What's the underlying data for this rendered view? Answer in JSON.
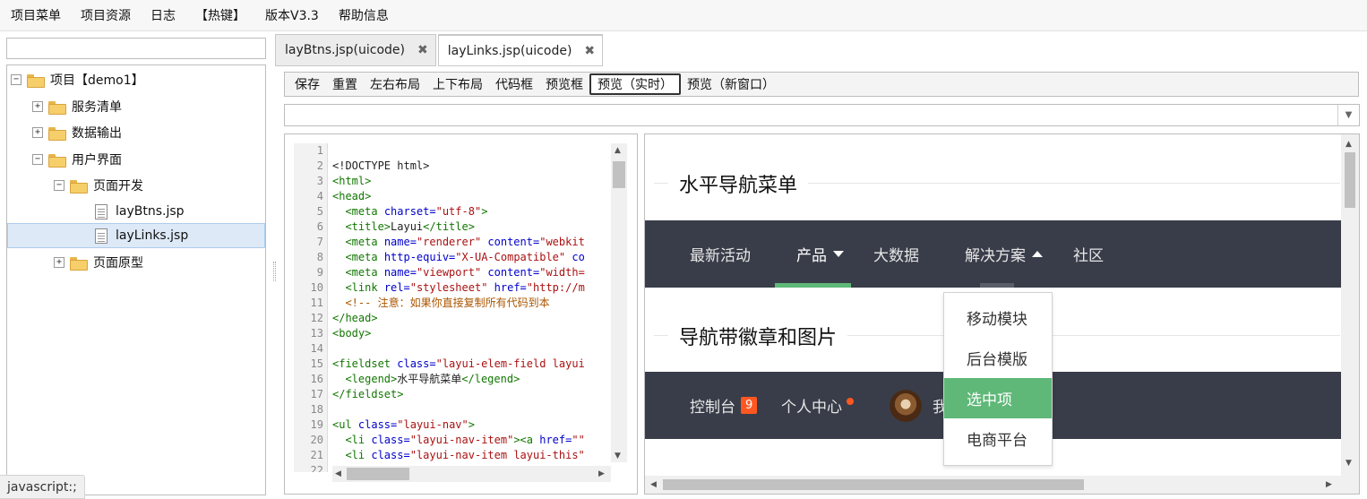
{
  "menu": [
    "项目菜单",
    "项目资源",
    "日志",
    "【热键】",
    "版本V3.3",
    "帮助信息"
  ],
  "tree": {
    "search_value": "",
    "nodes": [
      {
        "label": "项目【demo1】",
        "toggle": "−",
        "icon": "folder-open"
      },
      {
        "label": "服务清单",
        "toggle": "+",
        "icon": "folder"
      },
      {
        "label": "数据输出",
        "toggle": "+",
        "icon": "folder"
      },
      {
        "label": "用户界面",
        "toggle": "−",
        "icon": "folder-open"
      },
      {
        "label": "页面开发",
        "toggle": "−",
        "icon": "folder-open"
      },
      {
        "label": "layBtns.jsp",
        "toggle": "",
        "icon": "file"
      },
      {
        "label": "layLinks.jsp",
        "toggle": "",
        "icon": "file",
        "selected": true
      },
      {
        "label": "页面原型",
        "toggle": "+",
        "icon": "folder"
      }
    ]
  },
  "tabs": [
    {
      "label": "layBtns.jsp(uicode)",
      "close": "✖"
    },
    {
      "label": "layLinks.jsp(uicode)",
      "close": "✖",
      "active": true
    }
  ],
  "toolbar": [
    "保存",
    "重置",
    "左右布局",
    "上下布局",
    "代码框",
    "预览框",
    "预览（实时）",
    "预览（新窗口）"
  ],
  "toolbar_active": "预览（实时）",
  "combo_value": "",
  "code": {
    "line_numbers": [
      "1",
      "2",
      "3",
      "4",
      "5",
      "6",
      "7",
      "8",
      "9",
      "10",
      "11",
      "12",
      "13",
      "14",
      "15",
      "16",
      "17",
      "18",
      "19",
      "20",
      "21",
      "22"
    ],
    "lines": [
      [],
      [
        [
          "tx",
          "<!DOCTYPE html>"
        ]
      ],
      [
        [
          "tg",
          "<html>"
        ]
      ],
      [
        [
          "tg",
          "<head>"
        ]
      ],
      [
        [
          "tx",
          "  "
        ],
        [
          "tg",
          "<meta "
        ],
        [
          "at",
          "charset="
        ],
        [
          "st",
          "\"utf-8\""
        ],
        [
          "tg",
          ">"
        ]
      ],
      [
        [
          "tx",
          "  "
        ],
        [
          "tg",
          "<title>"
        ],
        [
          "tx",
          "Layui"
        ],
        [
          "tg",
          "</title>"
        ]
      ],
      [
        [
          "tx",
          "  "
        ],
        [
          "tg",
          "<meta "
        ],
        [
          "at",
          "name="
        ],
        [
          "st",
          "\"renderer\""
        ],
        [
          "at",
          " content="
        ],
        [
          "st",
          "\"webkit"
        ]
      ],
      [
        [
          "tx",
          "  "
        ],
        [
          "tg",
          "<meta "
        ],
        [
          "at",
          "http-equiv="
        ],
        [
          "st",
          "\"X-UA-Compatible\""
        ],
        [
          "at",
          " co"
        ]
      ],
      [
        [
          "tx",
          "  "
        ],
        [
          "tg",
          "<meta "
        ],
        [
          "at",
          "name="
        ],
        [
          "st",
          "\"viewport\""
        ],
        [
          "at",
          " content="
        ],
        [
          "st",
          "\"width="
        ]
      ],
      [
        [
          "tx",
          "  "
        ],
        [
          "tg",
          "<link "
        ],
        [
          "at",
          "rel="
        ],
        [
          "st",
          "\"stylesheet\""
        ],
        [
          "at",
          " href="
        ],
        [
          "st",
          "\"http://m"
        ]
      ],
      [
        [
          "tx",
          "  "
        ],
        [
          "cm",
          "<!-- 注意：如果你直接复制所有代码到本"
        ]
      ],
      [
        [
          "tg",
          "</head>"
        ]
      ],
      [
        [
          "tg",
          "<body>"
        ]
      ],
      [],
      [
        [
          "tg",
          "<fieldset "
        ],
        [
          "at",
          "class="
        ],
        [
          "st",
          "\"layui-elem-field layui"
        ]
      ],
      [
        [
          "tx",
          "  "
        ],
        [
          "tg",
          "<legend>"
        ],
        [
          "tx",
          "水平导航菜单"
        ],
        [
          "tg",
          "</legend>"
        ]
      ],
      [
        [
          "tg",
          "</fieldset>"
        ]
      ],
      [],
      [
        [
          "tg",
          "<ul "
        ],
        [
          "at",
          "class="
        ],
        [
          "st",
          "\"layui-nav\""
        ],
        [
          "tg",
          ">"
        ]
      ],
      [
        [
          "tx",
          "  "
        ],
        [
          "tg",
          "<li "
        ],
        [
          "at",
          "class="
        ],
        [
          "st",
          "\"layui-nav-item\""
        ],
        [
          "tg",
          "><a "
        ],
        [
          "at",
          "href="
        ],
        [
          "st",
          "\"\""
        ]
      ],
      [
        [
          "tx",
          "  "
        ],
        [
          "tg",
          "<li "
        ],
        [
          "at",
          "class="
        ],
        [
          "st",
          "\"layui-nav-item layui-this\""
        ]
      ],
      []
    ]
  },
  "preview": {
    "section1_title": "水平导航菜单",
    "nav1": [
      "最新活动",
      "产品",
      "大数据",
      "解决方案",
      "社区"
    ],
    "section2_title": "导航带徽章和图片",
    "nav2": {
      "console": "控制台",
      "badge": "9",
      "personal": "个人中心",
      "user_partial": "我"
    },
    "dropdown": [
      "移动模块",
      "后台模版",
      "选中项",
      "电商平台"
    ],
    "dropdown_selected": "选中项",
    "accent_color": "#5fb878",
    "nav_bg_color": "#393d49",
    "badge_color": "#ff5722"
  },
  "status_text": "javascript:;"
}
